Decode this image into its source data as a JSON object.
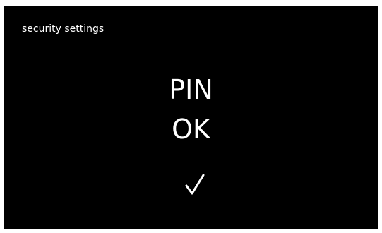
{
  "screen": {
    "title": "security settings",
    "status_line1": "PIN",
    "status_line2": "OK",
    "check_icon": "checkmark-icon",
    "background_color": "#000000",
    "text_color": "#ffffff"
  }
}
